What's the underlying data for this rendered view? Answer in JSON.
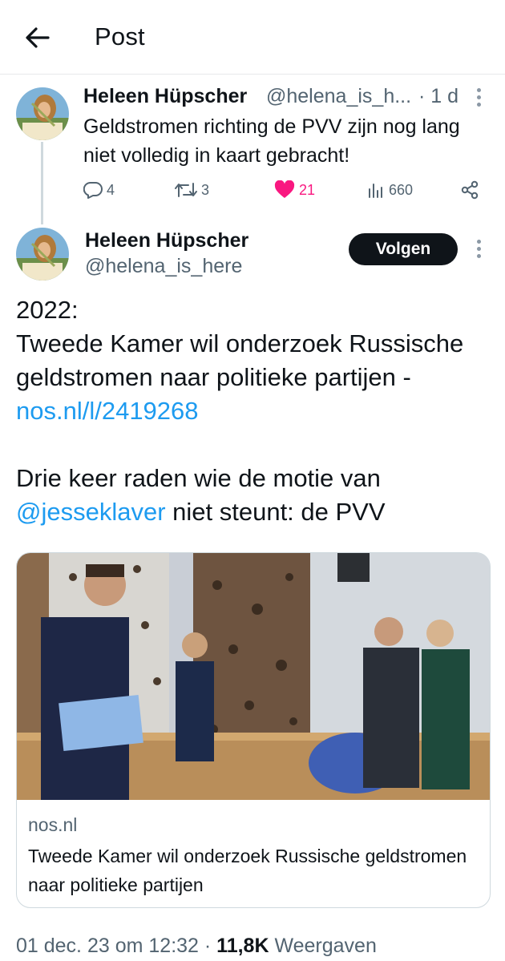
{
  "header": {
    "title": "Post"
  },
  "parent": {
    "name": "Heleen Hüpscher",
    "handle": "@helena_is_h...",
    "time": "· 1 d",
    "text": "Geldstromen richting de PVV zijn nog lang niet volledig in kaart gebracht!",
    "replies": "4",
    "reposts": "3",
    "likes": "21",
    "views": "660",
    "like_color": "#f91880"
  },
  "main": {
    "name": "Heleen Hüpscher",
    "handle": "@helena_is_here",
    "follow_label": "Volgen",
    "line1": "2022:",
    "line2": "Tweede Kamer wil onderzoek Russische geldstromen naar politieke partijen - ",
    "link": "nos.nl/l/2419268",
    "line3": "Drie keer raden wie de motie van ",
    "mention": "@jesseklaver",
    "line3_end": " niet steunt: de PVV",
    "link_color": "#1d9bf0"
  },
  "card": {
    "domain": "nos.nl",
    "title": "Tweede Kamer wil onderzoek Russische geldstromen naar politieke partijen"
  },
  "meta": {
    "timestamp": "01 dec. 23 om 12:32",
    "sep": " · ",
    "views": "11,8K",
    "views_label": " Weergaven"
  }
}
